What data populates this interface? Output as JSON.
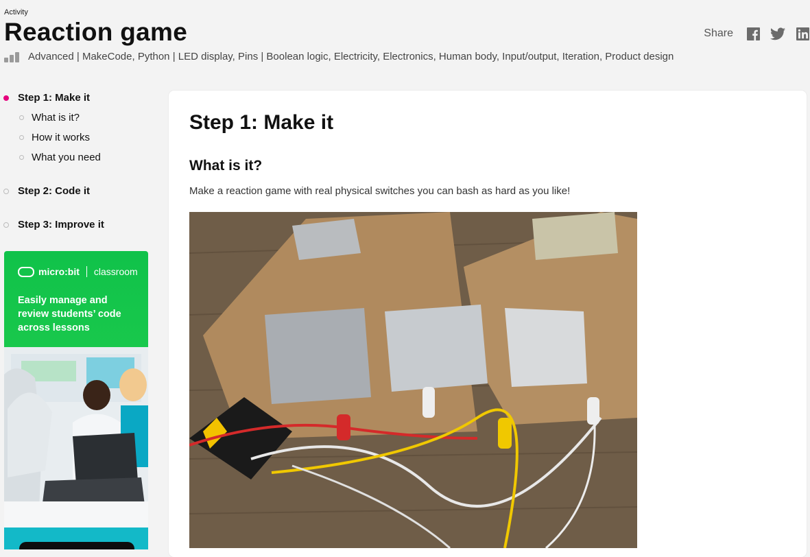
{
  "header": {
    "eyebrow": "Activity",
    "title": "Reaction game",
    "share_label": "Share",
    "share_icons": [
      "facebook-icon",
      "twitter-icon",
      "linkedin-icon"
    ]
  },
  "meta": {
    "level_icon": "difficulty-bars-icon",
    "text": "Advanced | MakeCode, Python | LED display, Pins | Boolean logic, Electricity, Electronics, Human body, Input/output, Iteration, Product design"
  },
  "nav": {
    "steps": [
      {
        "label": "Step 1: Make it",
        "active": true
      },
      {
        "label": "Step 2: Code it",
        "active": false
      },
      {
        "label": "Step 3: Improve it",
        "active": false
      }
    ],
    "subitems": [
      "What is it?",
      "How it works",
      "What you need"
    ]
  },
  "promo": {
    "logo_left": "micro:bit",
    "logo_right": "classroom",
    "text": "Easily manage and review students’ code across lessons"
  },
  "content": {
    "step_title": "Step 1: Make it",
    "section_title": "What is it?",
    "paragraph": "Make a reaction game with real physical switches you can bash as hard as you like!"
  },
  "colors": {
    "accent": "#e5007d",
    "promo_green": "#10c24a",
    "promo_teal": "#13b9c8"
  }
}
